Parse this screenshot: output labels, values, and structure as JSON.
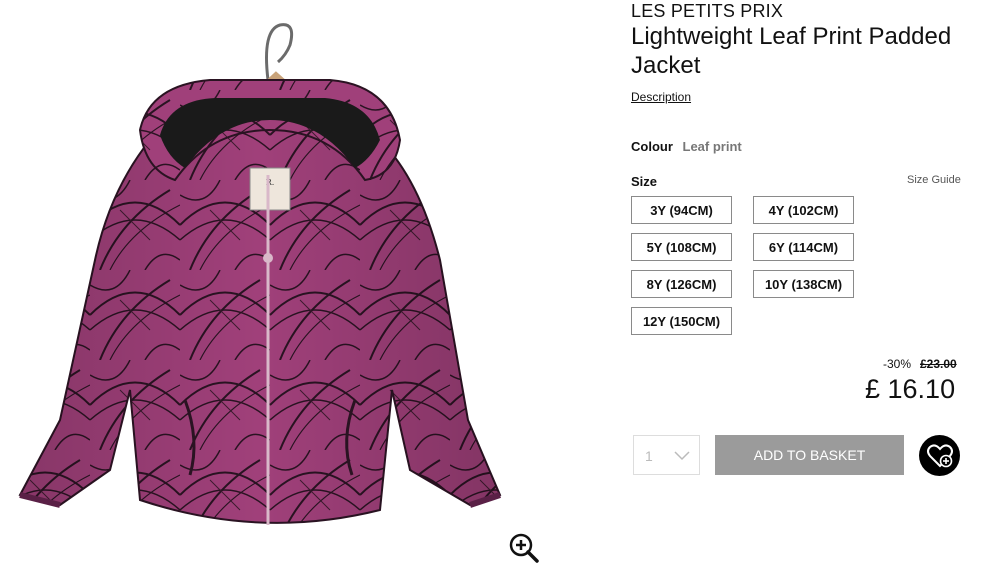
{
  "product": {
    "brand": "LES PETITS PRIX",
    "title": "Lightweight Leaf Print Padded Jacket",
    "description_link": "Description",
    "colour_label": "Colour",
    "colour_value": "Leaf print",
    "size_label": "Size",
    "size_guide": "Size Guide",
    "sizes": [
      "3Y (94CM)",
      "4Y (102CM)",
      "5Y (108CM)",
      "6Y (114CM)",
      "8Y (126CM)",
      "10Y (138CM)",
      "12Y (150CM)"
    ],
    "discount": "-30%",
    "old_price": "£23.00",
    "price": "£ 16.10",
    "quantity": "1",
    "add_to_basket": "ADD TO BASKET"
  },
  "colors": {
    "jacket": "#a0407a",
    "hood_lining": "#1a1a1a",
    "add_button": "#9b9b9b",
    "wishlist": "#000000"
  },
  "icons": {
    "zoom": "zoom-in-icon",
    "wishlist": "heart-plus-icon",
    "quantity": "chevron-down-icon"
  }
}
